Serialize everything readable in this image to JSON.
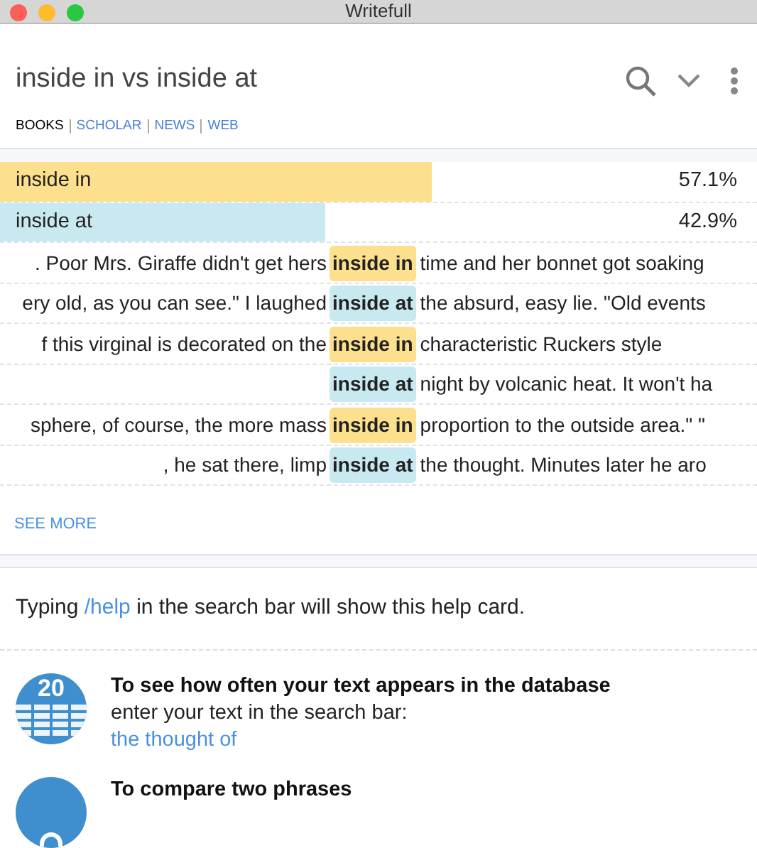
{
  "window": {
    "title": "Writefull"
  },
  "search": {
    "value": "inside in vs inside at"
  },
  "sources": [
    {
      "label": "BOOKS",
      "selected": true
    },
    {
      "label": "SCHOLAR",
      "selected": false
    },
    {
      "label": "NEWS",
      "selected": false
    },
    {
      "label": "WEB",
      "selected": false
    }
  ],
  "results": [
    {
      "phrase": "inside in",
      "percent": "57.1%",
      "level": 0.571,
      "color": "#fde08d"
    },
    {
      "phrase": "inside at",
      "percent": "42.9%",
      "level": 0.429,
      "color": "#c8e9ef"
    }
  ],
  "examples": [
    {
      "left": ". Poor Mrs. Giraffe didn't get hers",
      "keyword": "inside in",
      "right": "time and her bonnet got soaking",
      "color": "#fde08d"
    },
    {
      "left": "ery old, as you can see.\" I laughed",
      "keyword": "inside at",
      "right": "the absurd, easy lie. \"Old events",
      "color": "#c8e9ef"
    },
    {
      "left": "f this virginal is decorated on the",
      "keyword": "inside in",
      "right": "characteristic Ruckers style",
      "color": "#fde08d"
    },
    {
      "keyword": "inside at",
      "right": "night by volcanic heat. It won't ha",
      "color": "#c8e9ef"
    },
    {
      "left": "sphere, of course, the more mass",
      "keyword": "inside in",
      "right": "proportion to the outside area.\" \"",
      "color": "#fde08d"
    },
    {
      "left": ", he sat there, limp",
      "keyword": "inside at",
      "right": "the thought. Minutes later he aro",
      "color": "#c8e9ef"
    }
  ],
  "see_more": "SEE MORE",
  "help": {
    "intro_before": "Typing",
    "command": "/help",
    "intro_after": "in the search bar will show this help card.",
    "tips": [
      {
        "kind": "frequency",
        "icon_text": "20",
        "title": "To see how often your text appears in the database",
        "body": "enter your text in the search bar:",
        "example": "the thought of"
      },
      {
        "kind": "compare",
        "title": "To compare two phrases"
      }
    ]
  }
}
